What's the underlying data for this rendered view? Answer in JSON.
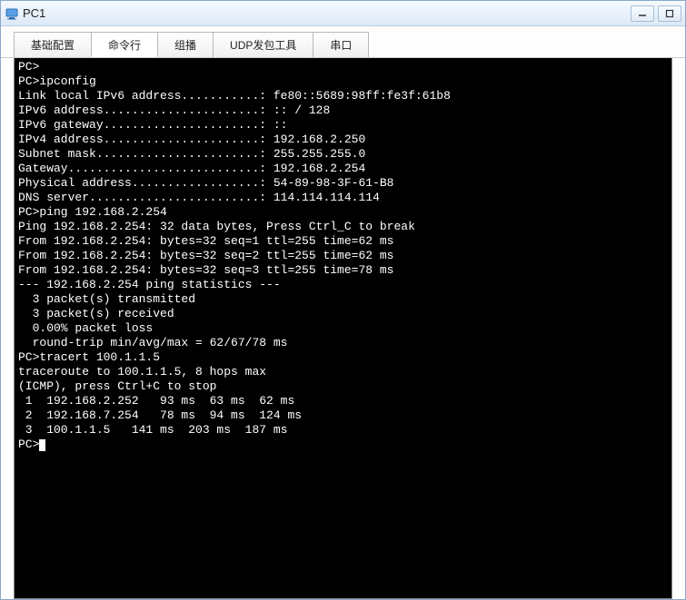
{
  "window": {
    "title": "PC1"
  },
  "tabs": [
    {
      "label": "基础配置"
    },
    {
      "label": "命令行"
    },
    {
      "label": "组播"
    },
    {
      "label": "UDP发包工具"
    },
    {
      "label": "串口"
    }
  ],
  "active_tab_index": 1,
  "terminal": {
    "lines": [
      "PC>",
      "PC>ipconfig",
      "",
      "Link local IPv6 address...........: fe80::5689:98ff:fe3f:61b8",
      "IPv6 address......................: :: / 128",
      "IPv6 gateway......................: ::",
      "IPv4 address......................: 192.168.2.250",
      "Subnet mask.......................: 255.255.255.0",
      "Gateway...........................: 192.168.2.254",
      "Physical address..................: 54-89-98-3F-61-B8",
      "DNS server........................: 114.114.114.114",
      "",
      "",
      "PC>ping 192.168.2.254",
      "",
      "Ping 192.168.2.254: 32 data bytes, Press Ctrl_C to break",
      "From 192.168.2.254: bytes=32 seq=1 ttl=255 time=62 ms",
      "From 192.168.2.254: bytes=32 seq=2 ttl=255 time=62 ms",
      "From 192.168.2.254: bytes=32 seq=3 ttl=255 time=78 ms",
      "",
      "--- 192.168.2.254 ping statistics ---",
      "  3 packet(s) transmitted",
      "  3 packet(s) received",
      "  0.00% packet loss",
      "  round-trip min/avg/max = 62/67/78 ms",
      "",
      "PC>tracert 100.1.1.5",
      "",
      "traceroute to 100.1.1.5, 8 hops max",
      "(ICMP), press Ctrl+C to stop",
      " 1  192.168.2.252   93 ms  63 ms  62 ms",
      " 2  192.168.7.254   78 ms  94 ms  124 ms",
      " 3  100.1.1.5   141 ms  203 ms  187 ms",
      "",
      "PC>"
    ]
  }
}
